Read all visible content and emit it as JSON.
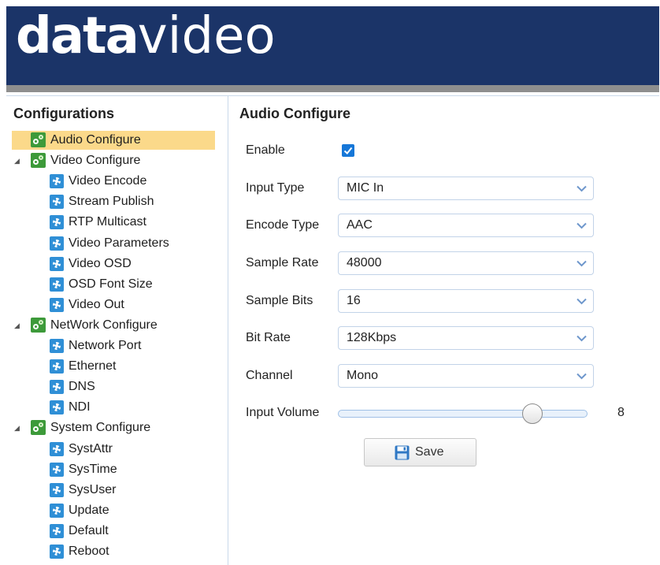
{
  "header": {
    "logo_bold": "data",
    "logo_thin": "video"
  },
  "sidebar": {
    "title": "Configurations",
    "items": [
      {
        "label": "Audio Configure",
        "level": 0,
        "icon": "group-gear-icon",
        "selected": true,
        "expander": ""
      },
      {
        "label": "Video Configure",
        "level": 0,
        "icon": "group-gear-icon",
        "selected": false,
        "expander": "◢"
      },
      {
        "label": "Video Encode",
        "level": 1,
        "icon": "gear-icon"
      },
      {
        "label": "Stream Publish",
        "level": 1,
        "icon": "gear-icon"
      },
      {
        "label": "RTP Multicast",
        "level": 1,
        "icon": "gear-icon"
      },
      {
        "label": "Video Parameters",
        "level": 1,
        "icon": "gear-icon"
      },
      {
        "label": "Video OSD",
        "level": 1,
        "icon": "gear-icon"
      },
      {
        "label": "OSD Font Size",
        "level": 1,
        "icon": "gear-icon"
      },
      {
        "label": "Video Out",
        "level": 1,
        "icon": "gear-icon"
      },
      {
        "label": "NetWork Configure",
        "level": 0,
        "icon": "group-gear-icon",
        "selected": false,
        "expander": "◢"
      },
      {
        "label": "Network Port",
        "level": 1,
        "icon": "gear-icon"
      },
      {
        "label": "Ethernet",
        "level": 1,
        "icon": "gear-icon"
      },
      {
        "label": "DNS",
        "level": 1,
        "icon": "gear-icon"
      },
      {
        "label": "NDI",
        "level": 1,
        "icon": "gear-icon"
      },
      {
        "label": "System Configure",
        "level": 0,
        "icon": "group-gear-icon",
        "selected": false,
        "expander": "◢"
      },
      {
        "label": "SystAttr",
        "level": 1,
        "icon": "gear-icon"
      },
      {
        "label": "SysTime",
        "level": 1,
        "icon": "gear-icon"
      },
      {
        "label": "SysUser",
        "level": 1,
        "icon": "gear-icon"
      },
      {
        "label": "Update",
        "level": 1,
        "icon": "gear-icon"
      },
      {
        "label": "Default",
        "level": 1,
        "icon": "gear-icon"
      },
      {
        "label": "Reboot",
        "level": 1,
        "icon": "gear-icon"
      }
    ]
  },
  "main": {
    "title": "Audio Configure",
    "enable_label": "Enable",
    "enable_checked": true,
    "fields": [
      {
        "label": "Input Type",
        "value": "MIC In"
      },
      {
        "label": "Encode Type",
        "value": "AAC"
      },
      {
        "label": "Sample Rate",
        "value": "48000"
      },
      {
        "label": "Sample Bits",
        "value": "16"
      },
      {
        "label": "Bit Rate",
        "value": "128Kbps"
      },
      {
        "label": "Channel",
        "value": "Mono"
      }
    ],
    "volume_label": "Input Volume",
    "volume_value": "8",
    "save_label": "Save"
  },
  "colors": {
    "header_bg": "#1b3468",
    "selected_bg": "#fbd98a",
    "group_icon": "#3d9a3a",
    "item_icon": "#2f8fd6",
    "checkbox": "#1677d8"
  }
}
